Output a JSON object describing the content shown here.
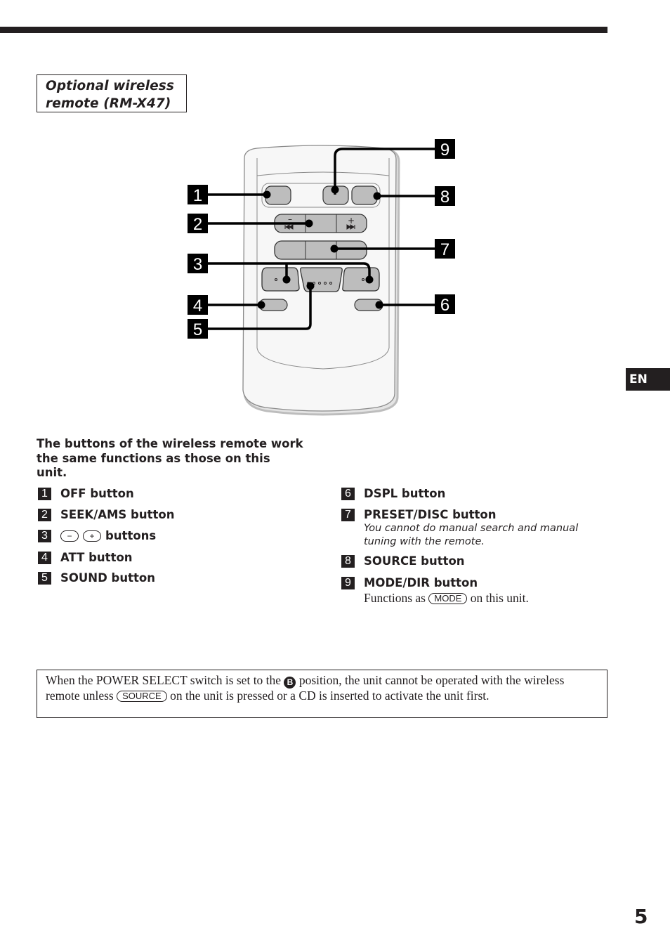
{
  "section": {
    "title_line1": "Optional wireless",
    "title_line2": "remote (RM-X47)"
  },
  "side_tab": {
    "language": "EN"
  },
  "page_number": "5",
  "diagram": {
    "callouts": [
      "1",
      "2",
      "3",
      "4",
      "5",
      "6",
      "7",
      "8",
      "9"
    ],
    "remote_glyphs": {
      "minus": "–",
      "plus": "+",
      "prev": "⏮",
      "next": "⏭"
    }
  },
  "intro": "The buttons of the wireless remote work the same functions as those on this unit.",
  "left_items": [
    {
      "num": "1",
      "label": "OFF button"
    },
    {
      "num": "2",
      "label": "SEEK/AMS button"
    },
    {
      "num": "3",
      "minus": "−",
      "plus": "+",
      "label": "buttons"
    },
    {
      "num": "4",
      "label": "ATT button"
    },
    {
      "num": "5",
      "label": "SOUND button"
    }
  ],
  "right_items": [
    {
      "num": "6",
      "label": "DSPL button"
    },
    {
      "num": "7",
      "label": "PRESET/DISC button",
      "note": "You cannot do manual search and manual tuning with the remote."
    },
    {
      "num": "8",
      "label": "SOURCE button"
    },
    {
      "num": "9",
      "label": "MODE/DIR button",
      "note_before": "Functions as",
      "note_key": "MODE",
      "note_after": "on this unit."
    }
  ],
  "notice": {
    "part1": "When the POWER SELECT switch is set to the",
    "badge": "B",
    "part2": "position, the unit cannot be operated with the wireless remote unless",
    "key": "SOURCE",
    "part3": "on the unit is pressed or a CD is inserted to activate the unit first."
  }
}
